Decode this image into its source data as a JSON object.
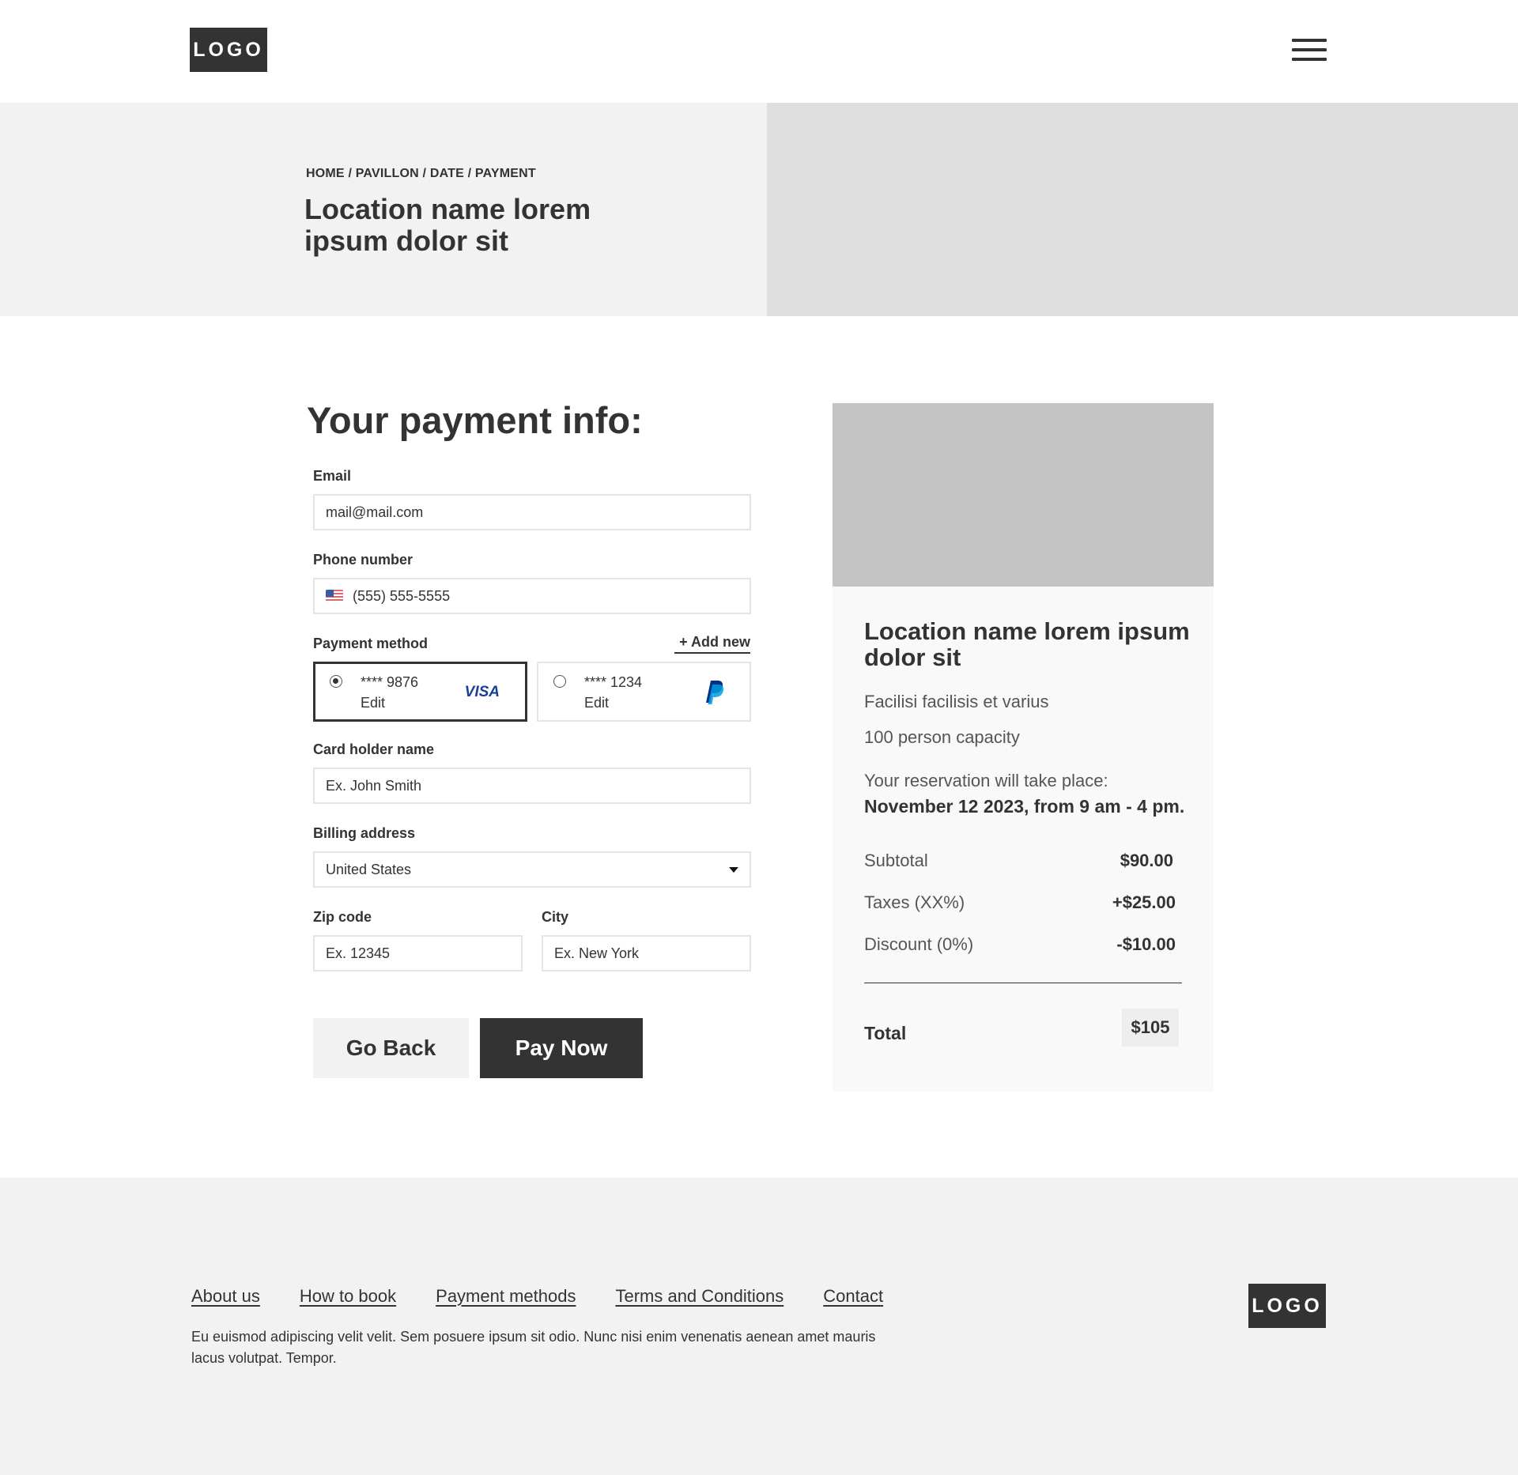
{
  "header": {
    "logo": "LOGO",
    "menu_icon": "hamburger-menu-icon"
  },
  "hero": {
    "breadcrumb": [
      "HOME",
      "PAVILLON",
      "DATE",
      "PAYMENT"
    ],
    "breadcrumb_separator": " / ",
    "title": "Location name lorem ipsum dolor sit"
  },
  "form": {
    "title": "Your payment info:",
    "email": {
      "label": "Email",
      "value": "mail@mail.com"
    },
    "phone": {
      "label": "Phone number",
      "value": "(555) 555-5555",
      "flag_icon": "us-flag-icon"
    },
    "payment_method": {
      "label": "Payment method",
      "add_new": "+ Add new",
      "cards": [
        {
          "number": "**** 9876",
          "edit": "Edit",
          "brand": "VISA",
          "selected": true
        },
        {
          "number": "**** 1234",
          "edit": "Edit",
          "brand": "paypal-icon",
          "selected": false
        }
      ]
    },
    "card_holder": {
      "label": "Card holder name",
      "placeholder": "Ex. John Smith"
    },
    "billing_address": {
      "label": "Billing address",
      "value": "United States"
    },
    "zip": {
      "label": "Zip code",
      "placeholder": "Ex. 12345"
    },
    "city": {
      "label": "City",
      "placeholder": "Ex. New York"
    },
    "buttons": {
      "back": "Go Back",
      "pay": "Pay Now"
    }
  },
  "summary": {
    "title": "Location name lorem ipsum dolor sit",
    "description": "Facilisi facilisis et varius",
    "capacity": "100 person capacity",
    "reservation_label": "Your reservation will take place:",
    "reservation_date": "November 12 2023, from 9 am - 4 pm.",
    "rows": [
      {
        "label": "Subtotal",
        "value": "$90.00"
      },
      {
        "label": "Taxes (XX%)",
        "value": "+$25.00"
      },
      {
        "label": "Discount (0%)",
        "value": "-$10.00"
      }
    ],
    "total_label": "Total",
    "total_value": "$105"
  },
  "footer": {
    "links": [
      "About us",
      "How to book",
      "Payment methods",
      "Terms and Conditions",
      "Contact"
    ],
    "text": "Eu euismod adipiscing velit velit. Sem posuere ipsum sit odio. Nunc nisi enim venenatis aenean amet mauris lacus volutpat. Tempor.",
    "logo": "LOGO"
  },
  "colors": {
    "dark": "#333333",
    "hero_left_bg": "#f2f2f2",
    "hero_right_bg": "#dedede",
    "card_image_bg": "#c4c4c4",
    "visa_blue": "#1a3e9a",
    "paypal_dark_blue": "#003087",
    "paypal_light_blue": "#009cde"
  }
}
